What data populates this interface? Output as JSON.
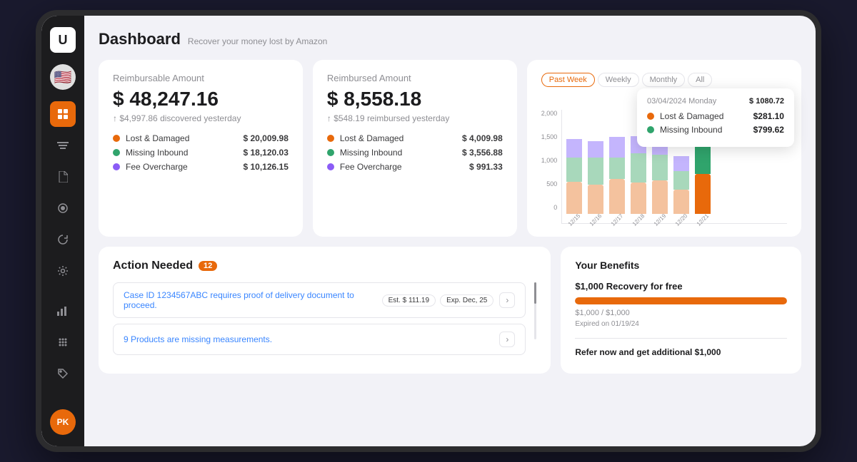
{
  "device": {
    "sidebar": {
      "logo": "U",
      "flag_emoji": "🇺🇸",
      "avatar_initials": "PK",
      "items": [
        {
          "id": "flag",
          "icon": "🇺🇸",
          "active": false
        },
        {
          "id": "grid",
          "icon": "⊞",
          "active": true
        },
        {
          "id": "truck",
          "icon": "🚚",
          "active": false
        },
        {
          "id": "doc",
          "icon": "📄",
          "active": false
        },
        {
          "id": "circle",
          "icon": "◎",
          "active": false
        },
        {
          "id": "refresh",
          "icon": "↻",
          "active": false
        },
        {
          "id": "settings",
          "icon": "⚙",
          "active": false
        },
        {
          "id": "chart2",
          "icon": "📊",
          "active": false
        },
        {
          "id": "grid2",
          "icon": "⋮⋮",
          "active": false
        },
        {
          "id": "tag",
          "icon": "🏷",
          "active": false
        }
      ]
    },
    "header": {
      "title": "Dashboard",
      "subtitle": "Recover your money lost by Amazon"
    },
    "reimbursable_card": {
      "label": "Reimbursable Amount",
      "amount": "$ 48,247.16",
      "change": "↑ $4,997.86",
      "change_suffix": "discovered yesterday",
      "breakdown": [
        {
          "label": "Lost & Damaged",
          "value": "$ 20,009.98",
          "color": "orange"
        },
        {
          "label": "Missing Inbound",
          "value": "$ 18,120.03",
          "color": "green"
        },
        {
          "label": "Fee Overcharge",
          "value": "$ 10,126.15",
          "color": "purple"
        }
      ]
    },
    "reimbursed_card": {
      "label": "Reimbursed Amount",
      "amount": "$ 8,558.18",
      "change": "↑ $548.19",
      "change_suffix": "reimbursed yesterday",
      "breakdown": [
        {
          "label": "Lost & Damaged",
          "value": "$ 4,009.98",
          "color": "orange"
        },
        {
          "label": "Missing Inbound",
          "value": "$ 3,556.88",
          "color": "green"
        },
        {
          "label": "Fee Overcharge",
          "value": "$ 991.33",
          "color": "purple"
        }
      ]
    },
    "chart_card": {
      "tabs": [
        "Past Week",
        "Weekly",
        "Monthly",
        "All"
      ],
      "active_tab": "Past Week",
      "tooltip": {
        "date": "03/04/2024 Monday",
        "amount": "$ 1080.72",
        "items": [
          {
            "label": "Lost & Damaged",
            "value": "$281.10",
            "color": "orange"
          },
          {
            "label": "Missing Inbound",
            "value": "$799.62",
            "color": "green"
          }
        ]
      },
      "y_labels": [
        "0",
        "500",
        "1,000",
        "1,500",
        "2,000"
      ],
      "bars": [
        {
          "date": "12/15",
          "orange": 60,
          "green": 45,
          "purple": 35
        },
        {
          "date": "12/16",
          "orange": 55,
          "green": 50,
          "purple": 30
        },
        {
          "date": "12/17",
          "orange": 65,
          "green": 40,
          "purple": 38
        },
        {
          "date": "12/18",
          "orange": 58,
          "green": 55,
          "purple": 32
        },
        {
          "date": "12/19",
          "orange": 62,
          "green": 48,
          "purple": 36
        },
        {
          "date": "12/20",
          "orange": 45,
          "green": 35,
          "purple": 28
        },
        {
          "date": "12/21",
          "orange": 75,
          "green": 90,
          "purple": 20
        }
      ]
    },
    "action_card": {
      "title": "Action Needed",
      "badge": "12",
      "items": [
        {
          "text": "Case ID 1234567ABC requires proof of delivery document to proceed.",
          "tags": [
            "Est. $ 111.19",
            "Exp. Dec, 25"
          ]
        },
        {
          "text": "9 Products are missing measurements.",
          "tags": []
        }
      ]
    },
    "benefits_card": {
      "title": "Your Benefits",
      "promo_title": "$1,000 Recovery for free",
      "progress_percent": 100,
      "progress_text": "$1,000 / $1,000",
      "progress_subtext": "Expired on 01/19/24",
      "refer_text": "Refer now and get additional $1,000"
    }
  }
}
